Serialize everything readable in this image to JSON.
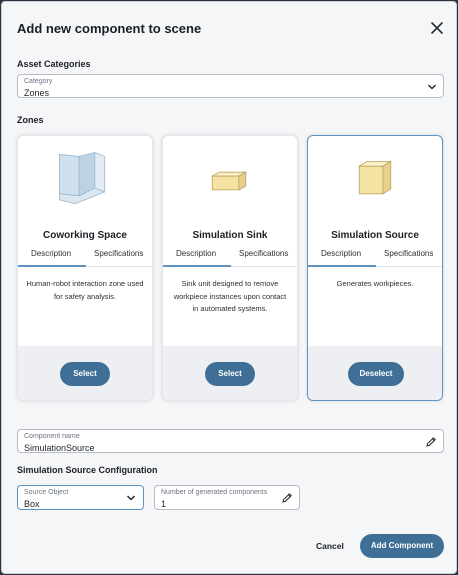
{
  "dialog": {
    "title": "Add new component to scene"
  },
  "asset_categories": {
    "section_label": "Asset Categories",
    "category_label": "Category",
    "category_value": "Zones"
  },
  "zones": {
    "section_label": "Zones",
    "cards": [
      {
        "title": "Coworking Space",
        "tab_description": "Description",
        "tab_specifications": "Specifications",
        "description": "Human-robot interaction zone used for safety analysis.",
        "button": "Select",
        "icon": "coworking-zone-icon"
      },
      {
        "title": "Simulation Sink",
        "tab_description": "Description",
        "tab_specifications": "Specifications",
        "description": "Sink unit designed to remove workpiece instances upon contact in automated systems.",
        "button": "Select",
        "icon": "sink-box-icon"
      },
      {
        "title": "Simulation Source",
        "tab_description": "Description",
        "tab_specifications": "Specifications",
        "description": "Generates workpieces.",
        "button": "Deselect",
        "icon": "source-box-icon",
        "selected": true
      }
    ]
  },
  "component_name": {
    "label": "Component name",
    "value": "SimulationSource"
  },
  "config": {
    "section_label": "Simulation Source Configuration",
    "source_object_label": "Source Object",
    "source_object_value": "Box",
    "count_label": "Number of generated components",
    "count_value": "1"
  },
  "actions": {
    "cancel": "Cancel",
    "add": "Add Component"
  },
  "colors": {
    "accent": "#3f6f96",
    "selected_border": "#5f93c2",
    "box_fill": "#f5e3a6"
  }
}
